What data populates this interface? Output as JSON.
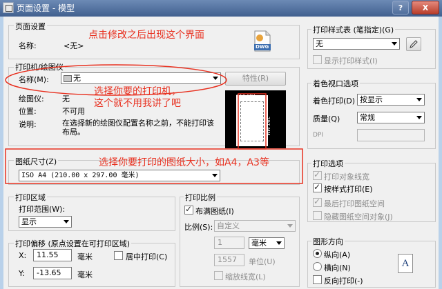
{
  "window": {
    "title": "页面设置 - 模型",
    "help": "?",
    "close": "X"
  },
  "page_setup": {
    "group_title": "页面设置",
    "name_label": "名称:",
    "name_value": "<无>",
    "dwg_icon_label": "DWG"
  },
  "printer": {
    "group_title": "打印机/绘图仪",
    "name_label": "名称(M):",
    "name_value": "无",
    "properties_button": "特性(R)",
    "plotter_label": "绘图仪:",
    "plotter_value": "无",
    "location_label": "位置:",
    "location_value": "不可用",
    "description_label": "说明:",
    "description_value": "在选择新的绘图仪配置名称之前，不能打印该布局。"
  },
  "preview": {
    "width_label": "210 MM",
    "height_label": "297 MM"
  },
  "paper_size": {
    "group_title": "图纸尺寸(Z)",
    "value": "ISO A4 (210.00 x 297.00 毫米)"
  },
  "plot_area": {
    "group_title": "打印区域",
    "range_label": "打印范围(W):",
    "range_value": "显示"
  },
  "plot_offset": {
    "group_title": "打印偏移 (原点设置在可打印区域)",
    "x_label": "X:",
    "x_value": "11.55",
    "x_unit": "毫米",
    "y_label": "Y:",
    "y_value": "-13.65",
    "y_unit": "毫米",
    "center_label": "居中打印(C)"
  },
  "plot_scale": {
    "group_title": "打印比例",
    "fit_label": "布满图纸(I)",
    "scale_label": "比例(S):",
    "scale_value": "自定义",
    "units_value": "1",
    "units_unit": "毫米",
    "drawing_units_value": "1557",
    "drawing_units_label": "单位(U)",
    "scale_lineweights_label": "缩放线宽(L)"
  },
  "plot_style_table": {
    "group_title": "打印样式表 (笔指定)(G)",
    "value": "无",
    "display_label": "显示打印样式(I)"
  },
  "shaded_viewport": {
    "group_title": "着色视口选项",
    "shade_plot_label": "着色打印(D)",
    "shade_plot_value": "按显示",
    "quality_label": "质量(Q)",
    "quality_value": "常规",
    "dpi_label": "DPI",
    "dpi_value": ""
  },
  "plot_options": {
    "group_title": "打印选项",
    "items": [
      {
        "label": "打印对象线宽"
      },
      {
        "label": "按样式打印(E)"
      },
      {
        "label": "最后打印图纸空间"
      },
      {
        "label": "隐藏图纸空间对象(J)"
      }
    ]
  },
  "orientation": {
    "group_title": "图形方向",
    "portrait_label": "纵向(A)",
    "landscape_label": "横向(N)",
    "upside_down_label": "反向打印(-)",
    "icon_letter": "A"
  },
  "annotations": {
    "note1": "点击修改之后出现这个界面",
    "note2_line1": "选择你要的打印机，",
    "note2_line2": "这个就不用我讲了吧",
    "note3": "选择你要打印的图纸大小，如A4，A3等"
  },
  "colors": {
    "annotation": "#e8301f",
    "title_bar": "#41608f"
  }
}
